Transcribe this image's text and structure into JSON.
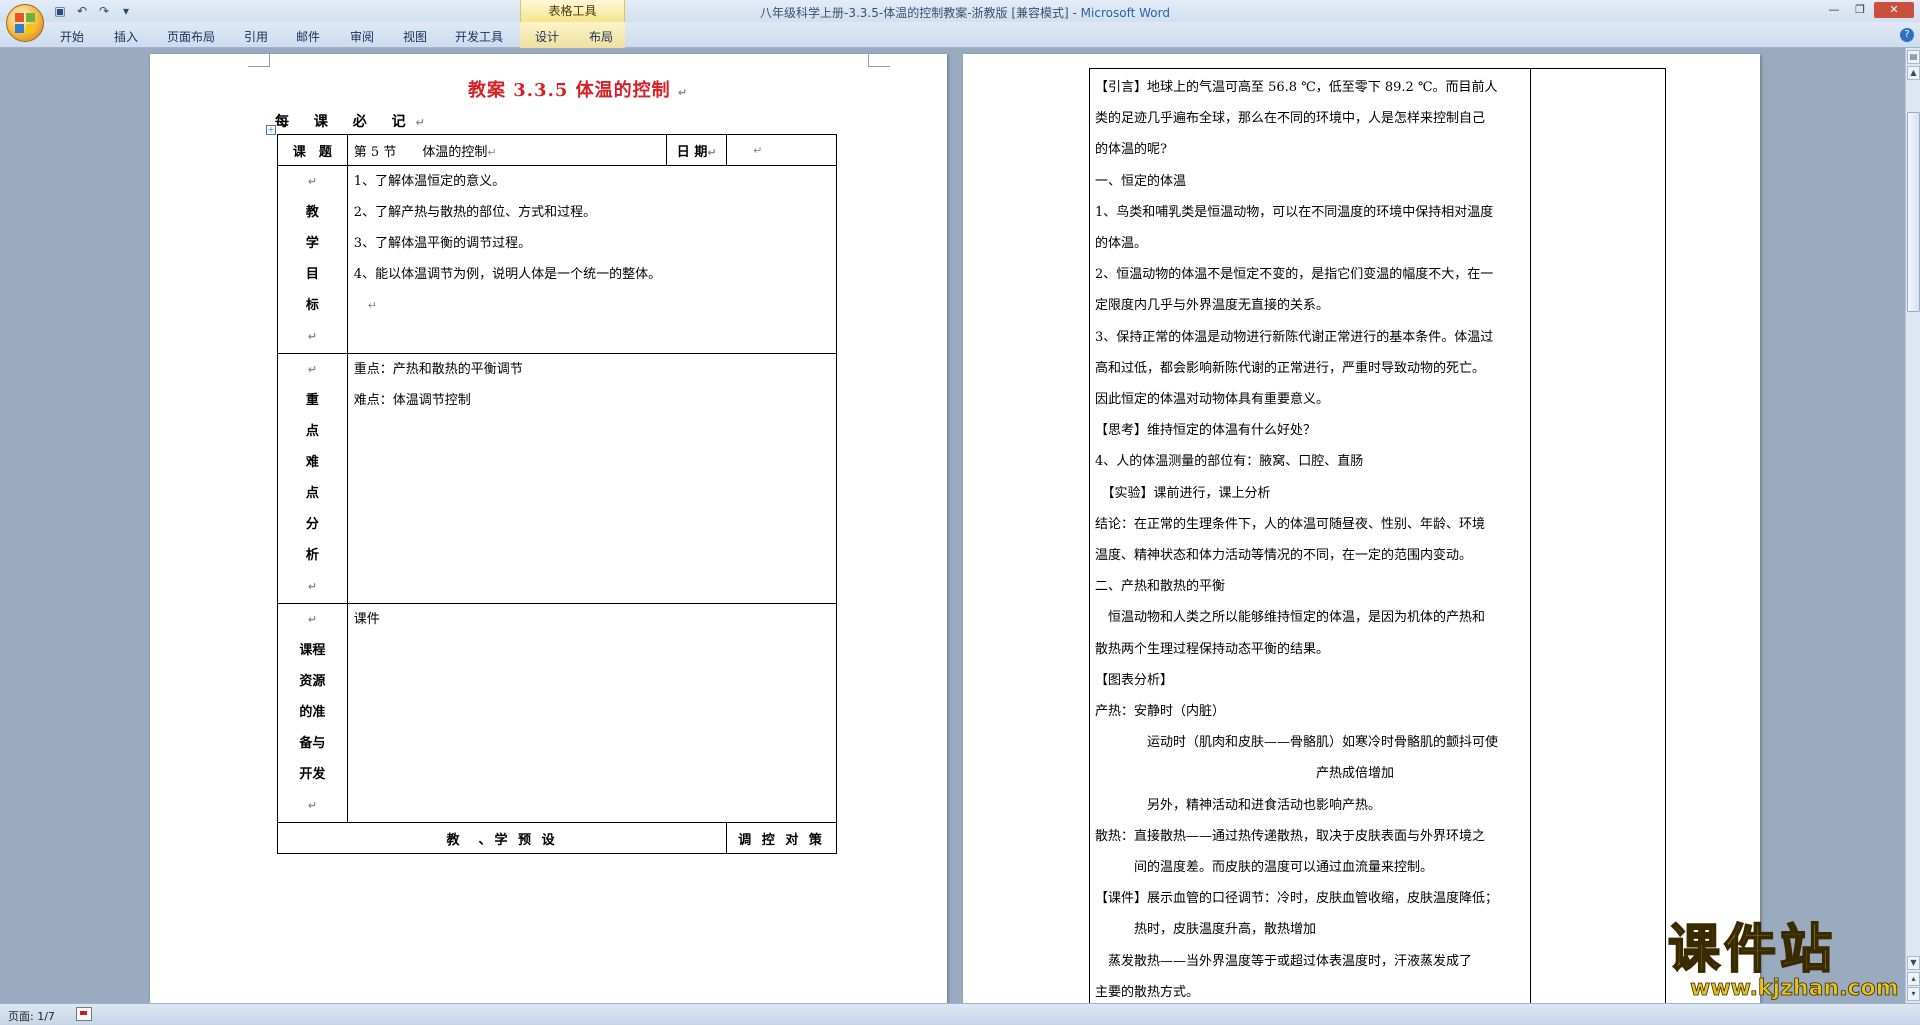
{
  "window": {
    "doc_title": "八年级科学上册-3.3.5-体温的控制教案-浙教版 [兼容模式] - ",
    "app_name": "Microsoft Word",
    "context_tab_group": "表格工具"
  },
  "quick_access": {
    "save_icon": "save-icon",
    "undo_icon": "undo-icon",
    "redo_icon": "redo-icon"
  },
  "ribbon_tabs": [
    "开始",
    "插入",
    "页面布局",
    "引用",
    "邮件",
    "审阅",
    "视图",
    "开发工具",
    "设计",
    "布局"
  ],
  "page1": {
    "title": "教案 3.3.5  体温的控制",
    "must_label": "每 课 必 记",
    "topic_label": "课　题",
    "topic_value": "第 5 节　　体温的控制",
    "date_label": "日 期",
    "goals_label": [
      "教",
      "学",
      "目",
      "标"
    ],
    "goals": [
      "1、了解体温恒定的意义。",
      "2、了解产热与散热的部位、方式和过程。",
      "3、了解体温平衡的调节过程。",
      "4、能以体温调节为例，说明人体是一个统一的整体。"
    ],
    "key_label": [
      "重",
      "点",
      "难",
      "点",
      "分",
      "析"
    ],
    "key_points": [
      "重点：产热和散热的平衡调节",
      "难点：体温调节控制"
    ],
    "resource_label": [
      "课程",
      "资源",
      "的准",
      "备与",
      "开发"
    ],
    "resource_value": "课件",
    "footer_left": "教　、学 预 设",
    "footer_right": "调 控 对 策"
  },
  "page2": {
    "paragraphs": [
      "【引言】地球上的气温可高至 56.8 ℃，低至零下 89.2 ℃。而目前人",
      "类的足迹几乎遍布全球，那么在不同的环境中，人是怎样来控制自己",
      "的体温的呢?",
      "一、恒定的体温",
      "1、鸟类和哺乳类是恒温动物，可以在不同温度的环境中保持相对温度",
      "的体温。",
      "2、恒温动物的体温不是恒定不变的，是指它们变温的幅度不大，在一",
      "定限度内几乎与外界温度无直接的关系。",
      "3、保持正常的体温是动物进行新陈代谢正常进行的基本条件。体温过",
      "高和过低，都会影响新陈代谢的正常进行，严重时导致动物的死亡。",
      "因此恒定的体温对动物体具有重要意义。",
      "【思考】维持恒定的体温有什么好处？",
      "4、人的体温测量的部位有：腋窝、口腔、直肠",
      "　【实验】课前进行，课上分析",
      "结论：在正常的生理条件下，人的体温可随昼夜、性别、年龄、环境",
      "温度、精神状态和体力活动等情况的不同，在一定的范围内变动。",
      "二、产热和散热的平衡",
      "　恒温动物和人类之所以能够维持恒定的体温，是因为机体的产热和",
      "散热两个生理过程保持动态平衡的结果。",
      "【图表分析】",
      "产热：安静时（内脏）",
      "　　　　运动时（肌肉和皮肤——骨骼肌）如寒冷时骨骼肌的颤抖可使",
      "　　　　　　　　　　　　　　　　　产热成倍增加",
      "　　　　另外，精神活动和进食活动也影响产热。",
      "散热：直接散热——通过热传递散热，取决于皮肤表面与外界环境之",
      "　　　间的温度差。而皮肤的温度可以通过血流量来控制。",
      "【课件】展示血管的口径调节：冷时，皮肤血管收缩，皮肤温度降低；",
      "　　　热时，皮肤温度升高，散热增加",
      "　蒸发散热——当外界温度等于或超过体表温度时，汗液蒸发成了",
      "主要的散热方式。"
    ]
  },
  "watermark": {
    "big": "课件站",
    "url": "www.kjzhan.com"
  },
  "status": {
    "page_info": "页面: 1/7"
  }
}
